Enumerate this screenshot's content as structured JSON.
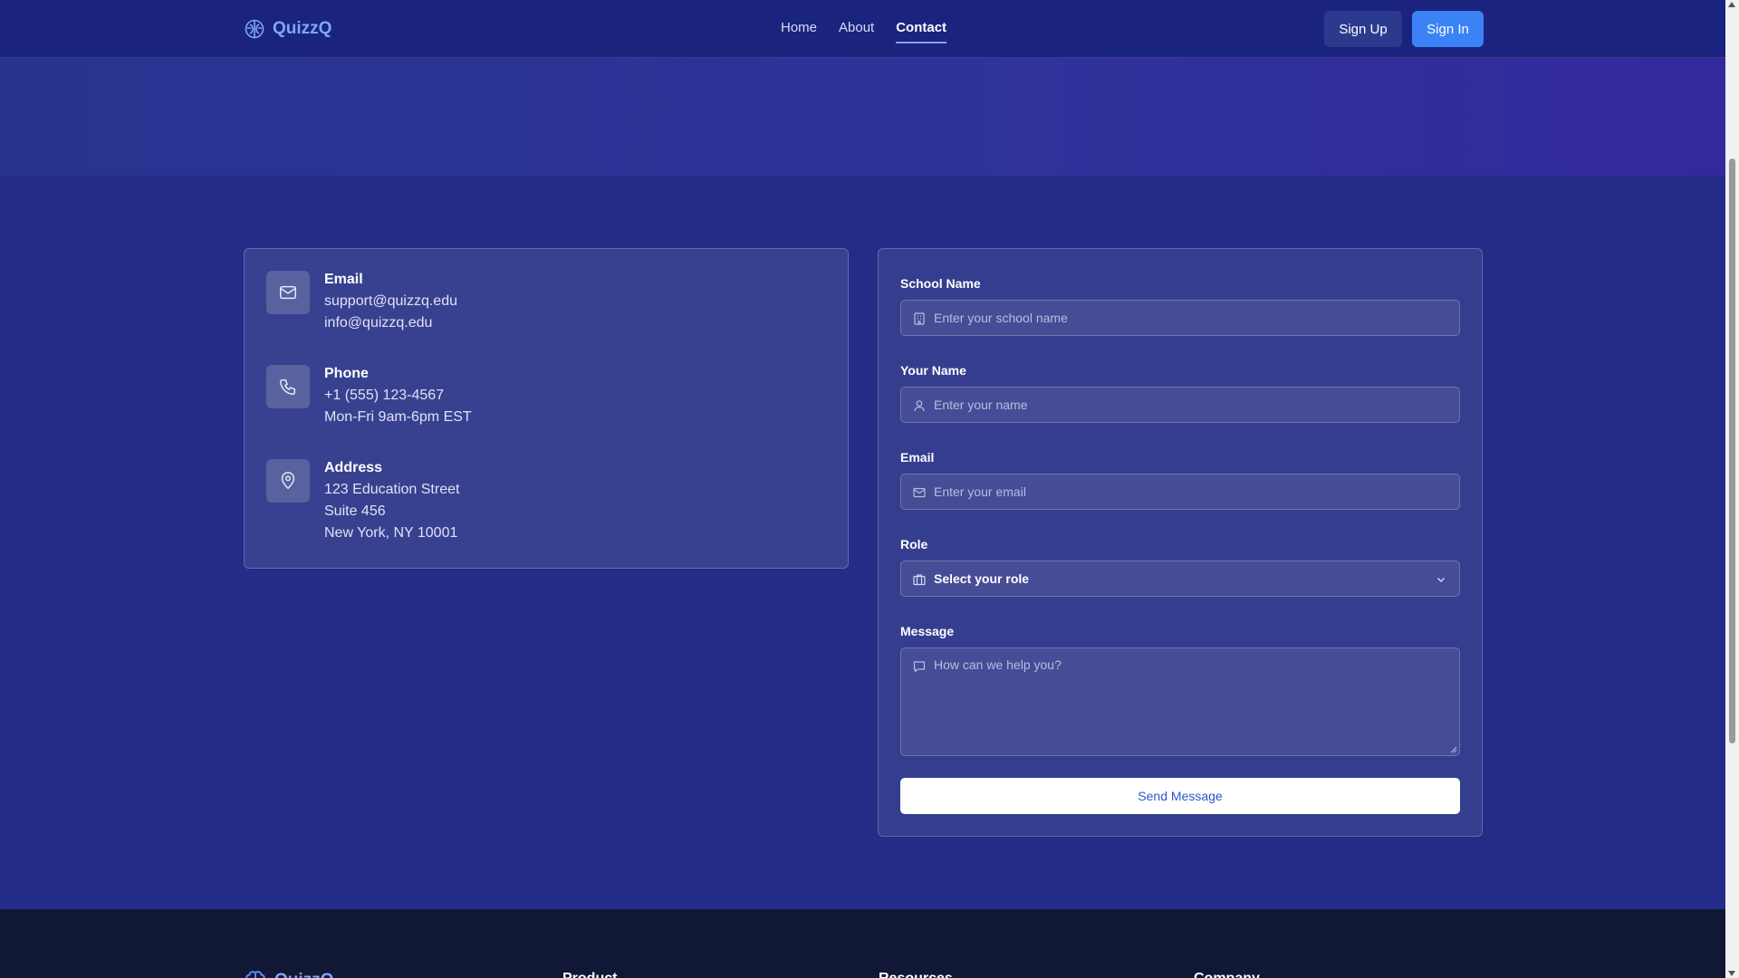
{
  "nav": {
    "brand": "QuizzQ",
    "links": [
      "Home",
      "About",
      "Contact"
    ],
    "active_link": "Contact",
    "signup_label": "Sign Up",
    "signin_label": "Sign In"
  },
  "contact_info": {
    "email": {
      "title": "Email",
      "lines": [
        "support@quizzq.edu",
        "info@quizzq.edu"
      ],
      "icon": "mail-icon"
    },
    "phone": {
      "title": "Phone",
      "lines": [
        "+1 (555) 123-4567",
        "Mon-Fri 9am-6pm EST"
      ],
      "icon": "phone-icon"
    },
    "address": {
      "title": "Address",
      "lines": [
        "123 Education Street",
        "Suite 456",
        "New York, NY 10001"
      ],
      "icon": "map-pin-icon"
    }
  },
  "form": {
    "school": {
      "label": "School Name",
      "placeholder": "Enter your school name",
      "icon": "building-icon"
    },
    "name": {
      "label": "Your Name",
      "placeholder": "Enter your name",
      "icon": "user-icon"
    },
    "email": {
      "label": "Email",
      "placeholder": "Enter your email",
      "icon": "mail-icon"
    },
    "role": {
      "label": "Role",
      "selected": "Select your role",
      "icon": "briefcase-icon"
    },
    "message": {
      "label": "Message",
      "placeholder": "How can we help you?",
      "icon": "message-icon"
    },
    "submit_label": "Send Message"
  },
  "footer": {
    "brand": "QuizzQ",
    "columns": [
      "Product",
      "Resources",
      "Company"
    ]
  },
  "colors": {
    "page_bg": "#232d87",
    "nav_bg": "#1a237e",
    "accent": "#3b82f6",
    "brand": "#7ea6ff",
    "footer_bg": "#101836"
  }
}
